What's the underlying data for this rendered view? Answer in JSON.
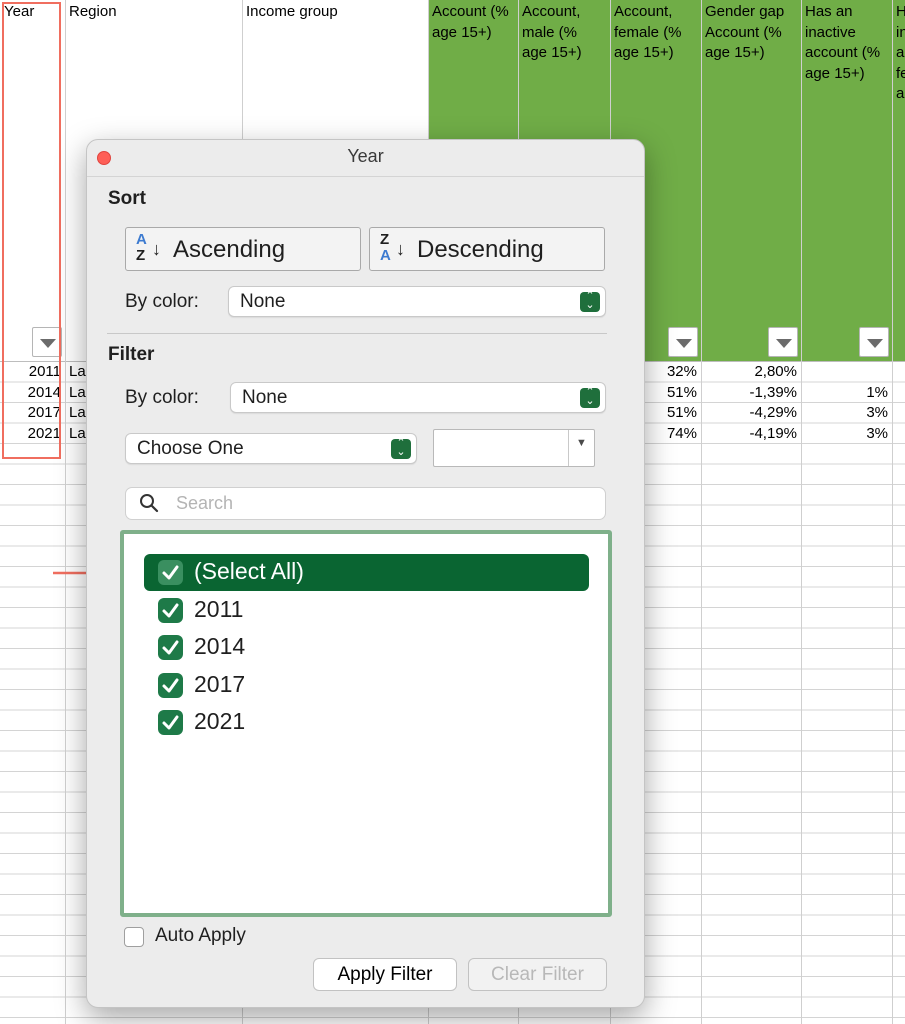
{
  "sheet": {
    "headers": [
      {
        "key": "year",
        "label": "Year"
      },
      {
        "key": "region",
        "label": "Region"
      },
      {
        "key": "income",
        "label": "Income group"
      },
      {
        "key": "acc",
        "label": "Account (% age 15+)"
      },
      {
        "key": "acc_m",
        "label": "Account, male (% age 15+)"
      },
      {
        "key": "acc_f",
        "label": "Account, female (% age 15+)"
      },
      {
        "key": "gap",
        "label": "Gender gap Account (% age 15+)"
      },
      {
        "key": "inactive",
        "label": "Has an inactive account (% age 15+)"
      },
      {
        "key": "h_partial",
        "label": "H in a fe a"
      }
    ],
    "rows": [
      {
        "year": "2011",
        "region": "La",
        "acc_f": "32%",
        "gap": "2,80%",
        "inactive": ""
      },
      {
        "year": "2014",
        "region": "La",
        "acc_f": "51%",
        "gap": "-1,39%",
        "inactive": "1%"
      },
      {
        "year": "2017",
        "region": "La",
        "acc_f": "51%",
        "gap": "-4,29%",
        "inactive": "3%"
      },
      {
        "year": "2021",
        "region": "La",
        "acc_f": "74%",
        "gap": "-4,19%",
        "inactive": "3%"
      }
    ],
    "colors": {
      "header_green": "#70ad47",
      "highlight": "#f06e5f"
    }
  },
  "dialog": {
    "title": "Year",
    "sort": {
      "heading": "Sort",
      "ascending_label": "Ascending",
      "descending_label": "Descending",
      "asc_icon": {
        "top": "A",
        "bottom": "Z"
      },
      "desc_icon": {
        "top": "Z",
        "bottom": "A"
      },
      "by_color_label": "By color:",
      "by_color_value": "None"
    },
    "filter": {
      "heading": "Filter",
      "by_color_label": "By color:",
      "by_color_value": "None",
      "condition_value": "Choose One",
      "search_placeholder": "Search",
      "items": [
        {
          "label": "(Select All)",
          "checked": true,
          "selected": true
        },
        {
          "label": "2011",
          "checked": true
        },
        {
          "label": "2014",
          "checked": true
        },
        {
          "label": "2017",
          "checked": true
        },
        {
          "label": "2021",
          "checked": true
        }
      ],
      "auto_apply_label": "Auto Apply",
      "auto_apply_checked": false,
      "apply_label": "Apply Filter",
      "clear_label": "Clear Filter"
    },
    "colors": {
      "accent": "#0a6532",
      "checkbox": "#1e7a48",
      "list_border": "#7fb08a"
    }
  }
}
